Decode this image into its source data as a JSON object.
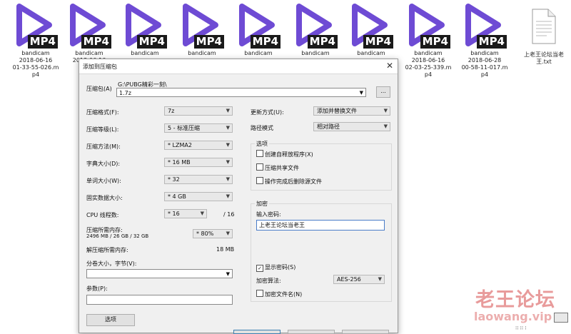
{
  "desktop": {
    "files": [
      {
        "name": "bandicam\n2018-06-16\n01-33-55-026.m\np4",
        "badge": "MP4"
      },
      {
        "name": "bandicam\n2018-06-16\n01-34",
        "badge": "MP4"
      },
      {
        "name": "bandicam",
        "badge": "MP4"
      },
      {
        "name": "bandicam",
        "badge": "MP4"
      },
      {
        "name": "bandicam",
        "badge": "MP4"
      },
      {
        "name": "bandicam",
        "badge": "MP4"
      },
      {
        "name": "bandicam",
        "badge": "MP4"
      },
      {
        "name": "bandicam\n2018-06-16\n02-03-25-339.m\np4",
        "badge": "MP4"
      },
      {
        "name": "bandicam\n2018-06-28\n00-58-11-017.m\np4",
        "badge": "MP4"
      }
    ],
    "txt_file": "上老王论坛当老\n王.txt"
  },
  "dialog": {
    "title": "添加到压缩包",
    "archive_label": "压缩包(A)",
    "archive_path": "G:\\PUBG精彩一刻\\",
    "archive_name": "1.7z",
    "browse_label": "...",
    "format_label": "压缩格式(F):",
    "format_value": "7z",
    "level_label": "压缩等级(L):",
    "level_value": "5 - 标准压缩",
    "method_label": "压缩方法(M):",
    "method_value": "* LZMA2",
    "dict_label": "字典大小(D):",
    "dict_value": "* 16 MB",
    "word_label": "单词大小(W):",
    "word_value": "* 32",
    "solid_label": "固实数据大小:",
    "solid_value": "* 4 GB",
    "cpu_label": "CPU 线程数:",
    "cpu_value": "* 16",
    "cpu_total": "/ 16",
    "mem_label": "压缩所需内存:",
    "mem_detail": "2496 MB / 26 GB / 32 GB",
    "mem_percent": "* 80%",
    "decomp_label": "解压缩所需内存:",
    "decomp_value": "18 MB",
    "split_label": "分卷大小，字节(V):",
    "params_label": "参数(P):",
    "options_button": "选项",
    "update_label": "更新方式(U):",
    "update_value": "添加并替换文件",
    "path_label": "路径模式",
    "path_value": "相对路径",
    "options_group": "选项",
    "opt_sfx": "创建自释放程序(X)",
    "opt_shared": "压缩共享文件",
    "opt_delete": "操作完成后删除源文件",
    "encrypt_group": "加密",
    "password_label": "输入密码:",
    "password_value": "上老王论坛当老王",
    "show_password": "显示密码(S)",
    "enc_method_label": "加密算法:",
    "enc_method_value": "AES-256",
    "encrypt_names": "加密文件名(N)"
  },
  "watermark": {
    "line1": "老王论坛",
    "line2": "laowang.vip"
  }
}
